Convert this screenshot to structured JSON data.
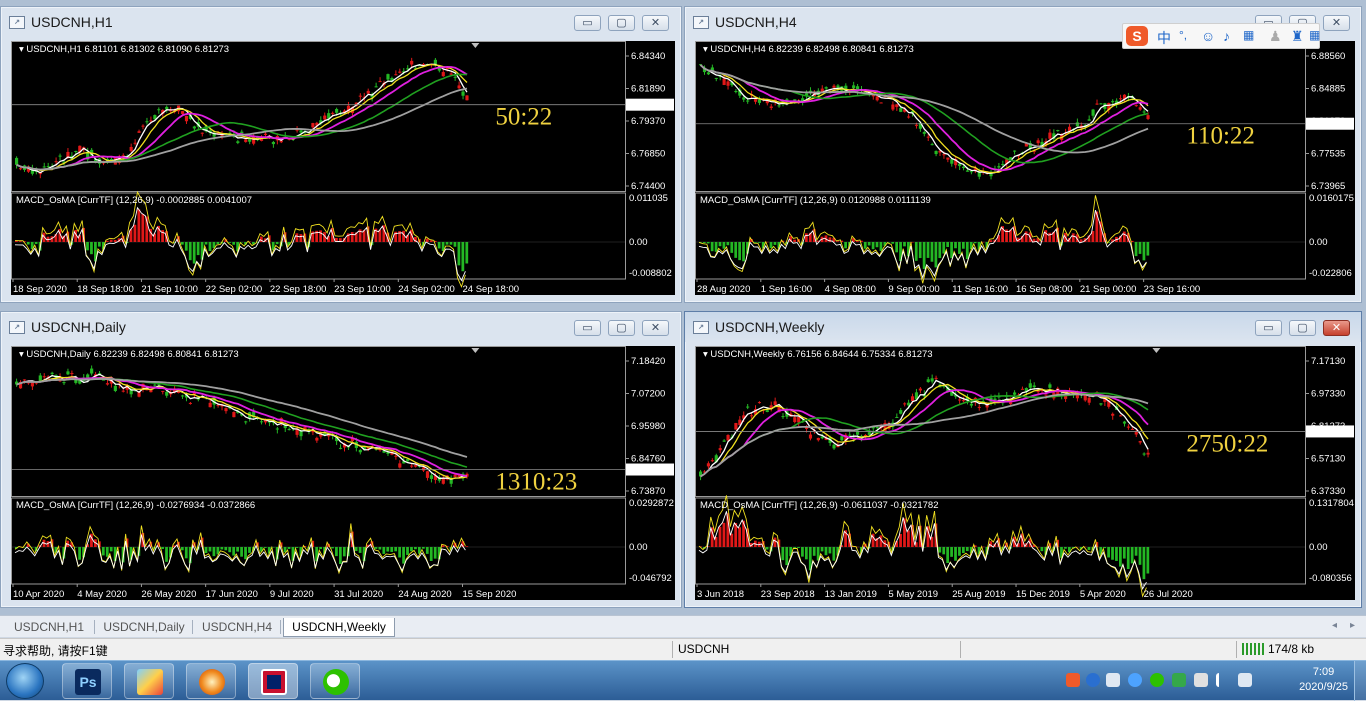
{
  "windows": [
    {
      "id": "h1",
      "title": "USDCNH,H1",
      "header_symbol": "USDCNH,H1",
      "header_ohlc": "6.81101 6.81302 6.81090 6.81273",
      "timer": "50:22",
      "price_labels": [
        "6.84340",
        "6.81890",
        "6.79370",
        "6.76850",
        "6.74400"
      ],
      "current_price": "6.81273",
      "indicator_label": "MACD_OsMA [CurrTF] (12,26,9) -0.0002885 0.0041007",
      "indicator_labels": [
        "0.011035",
        "0.00",
        "-0.008802"
      ],
      "time_labels": [
        "18 Sep 2020",
        "18 Sep 18:00",
        "21 Sep 10:00",
        "22 Sep 02:00",
        "22 Sep 18:00",
        "23 Sep 10:00",
        "24 Sep 02:00",
        "24 Sep 18:00"
      ],
      "close_active": false
    },
    {
      "id": "h4",
      "title": "USDCNH,H4",
      "header_symbol": "USDCNH,H4",
      "header_ohlc": "6.82239 6.82498 6.80841 6.81273",
      "timer": "110:22",
      "price_labels": [
        "6.88560",
        "6.84885",
        "6.81273",
        "6.77535",
        "6.73965"
      ],
      "current_price": "6.81273",
      "indicator_label": "MACD_OsMA [CurrTF] (12,26,9) 0.0120988 0.0111139",
      "indicator_labels": [
        "0.0160175",
        "0.00",
        "-0.022806"
      ],
      "time_labels": [
        "28 Aug 2020",
        "1 Sep 16:00",
        "4 Sep 08:00",
        "9 Sep 00:00",
        "11 Sep 16:00",
        "16 Sep 08:00",
        "21 Sep 00:00",
        "23 Sep 16:00"
      ],
      "close_active": false
    },
    {
      "id": "daily",
      "title": "USDCNH,Daily",
      "header_symbol": "USDCNH,Daily",
      "header_ohlc": "6.82239 6.82498 6.80841 6.81273",
      "timer": "1310:23",
      "price_labels": [
        "7.18420",
        "7.07200",
        "6.95980",
        "6.84760",
        "6.73870"
      ],
      "current_price": "6.81273",
      "indicator_label": "MACD_OsMA [CurrTF] (12,26,9) -0.0276934 -0.0372866",
      "indicator_labels": [
        "0.0292872",
        "0.00",
        "-0.046792"
      ],
      "time_labels": [
        "10 Apr 2020",
        "4 May 2020",
        "26 May 2020",
        "17 Jun 2020",
        "9 Jul 2020",
        "31 Jul 2020",
        "24 Aug 2020",
        "15 Sep 2020"
      ],
      "close_active": false
    },
    {
      "id": "weekly",
      "title": "USDCNH,Weekly",
      "header_symbol": "USDCNH,Weekly",
      "header_ohlc": "6.76156 6.84644 6.75334 6.81273",
      "timer": "2750:22",
      "price_labels": [
        "7.17130",
        "6.97330",
        "6.81273",
        "6.57130",
        "6.37330"
      ],
      "current_price": "6.81273",
      "indicator_label": "MACD_OsMA [CurrTF] (12,26,9) -0.0611037 -0.0321782",
      "indicator_labels": [
        "0.1317804",
        "0.00",
        "-0.080356"
      ],
      "time_labels": [
        "3 Jun 2018",
        "23 Sep 2018",
        "13 Jan 2019",
        "5 May 2019",
        "25 Aug 2019",
        "15 Dec 2019",
        "5 Apr 2020",
        "26 Jul 2020"
      ],
      "close_active": true
    }
  ],
  "window_buttons": {
    "minimize": "▭",
    "maximize": "▢",
    "close": "✕"
  },
  "chart_icon_text": "↗",
  "tabs": [
    "USDCNH,H1",
    "USDCNH,Daily",
    "USDCNH,H4",
    "USDCNH,Weekly"
  ],
  "active_tab": "USDCNH,Weekly",
  "tab_nav": {
    "left": "◂",
    "right": "▸"
  },
  "status_bar": {
    "help": "寻求帮助, 请按F1键",
    "symbol": "USDCNH",
    "traffic": "174/8 kb"
  },
  "ime_bar": {
    "logo": "S",
    "lang": "中",
    "punct": "°,"
  },
  "taskbar": {
    "apps": [
      {
        "name": "photoshop",
        "label": "Ps"
      },
      {
        "name": "paint",
        "label": ""
      },
      {
        "name": "browser",
        "label": ""
      },
      {
        "name": "flag",
        "label": ""
      },
      {
        "name": "wechat",
        "label": ""
      }
    ],
    "time": "7:09",
    "date": "2020/9/25"
  },
  "colors": {
    "candle_up": "#e01818",
    "candle_down": "#24b824",
    "ma_fast": "#ffffff",
    "ma_mid": "#f0e020",
    "ma_magenta": "#e020e0",
    "ma_green": "#20a020",
    "ma_gray": "#a0a0a0",
    "timer": "#f0d240"
  },
  "chart_data": [
    {
      "type": "candlestick",
      "title": "USDCNH,H1",
      "ylim": [
        6.744,
        6.8434
      ],
      "current": 6.81273
    },
    {
      "type": "candlestick",
      "title": "USDCNH,H4",
      "ylim": [
        6.73965,
        6.8856
      ],
      "current": 6.81273
    },
    {
      "type": "candlestick",
      "title": "USDCNH,Daily",
      "ylim": [
        6.7387,
        7.1842
      ],
      "current": 6.81273
    },
    {
      "type": "candlestick",
      "title": "USDCNH,Weekly",
      "ylim": [
        6.3733,
        7.1713
      ],
      "current": 6.81273
    }
  ]
}
